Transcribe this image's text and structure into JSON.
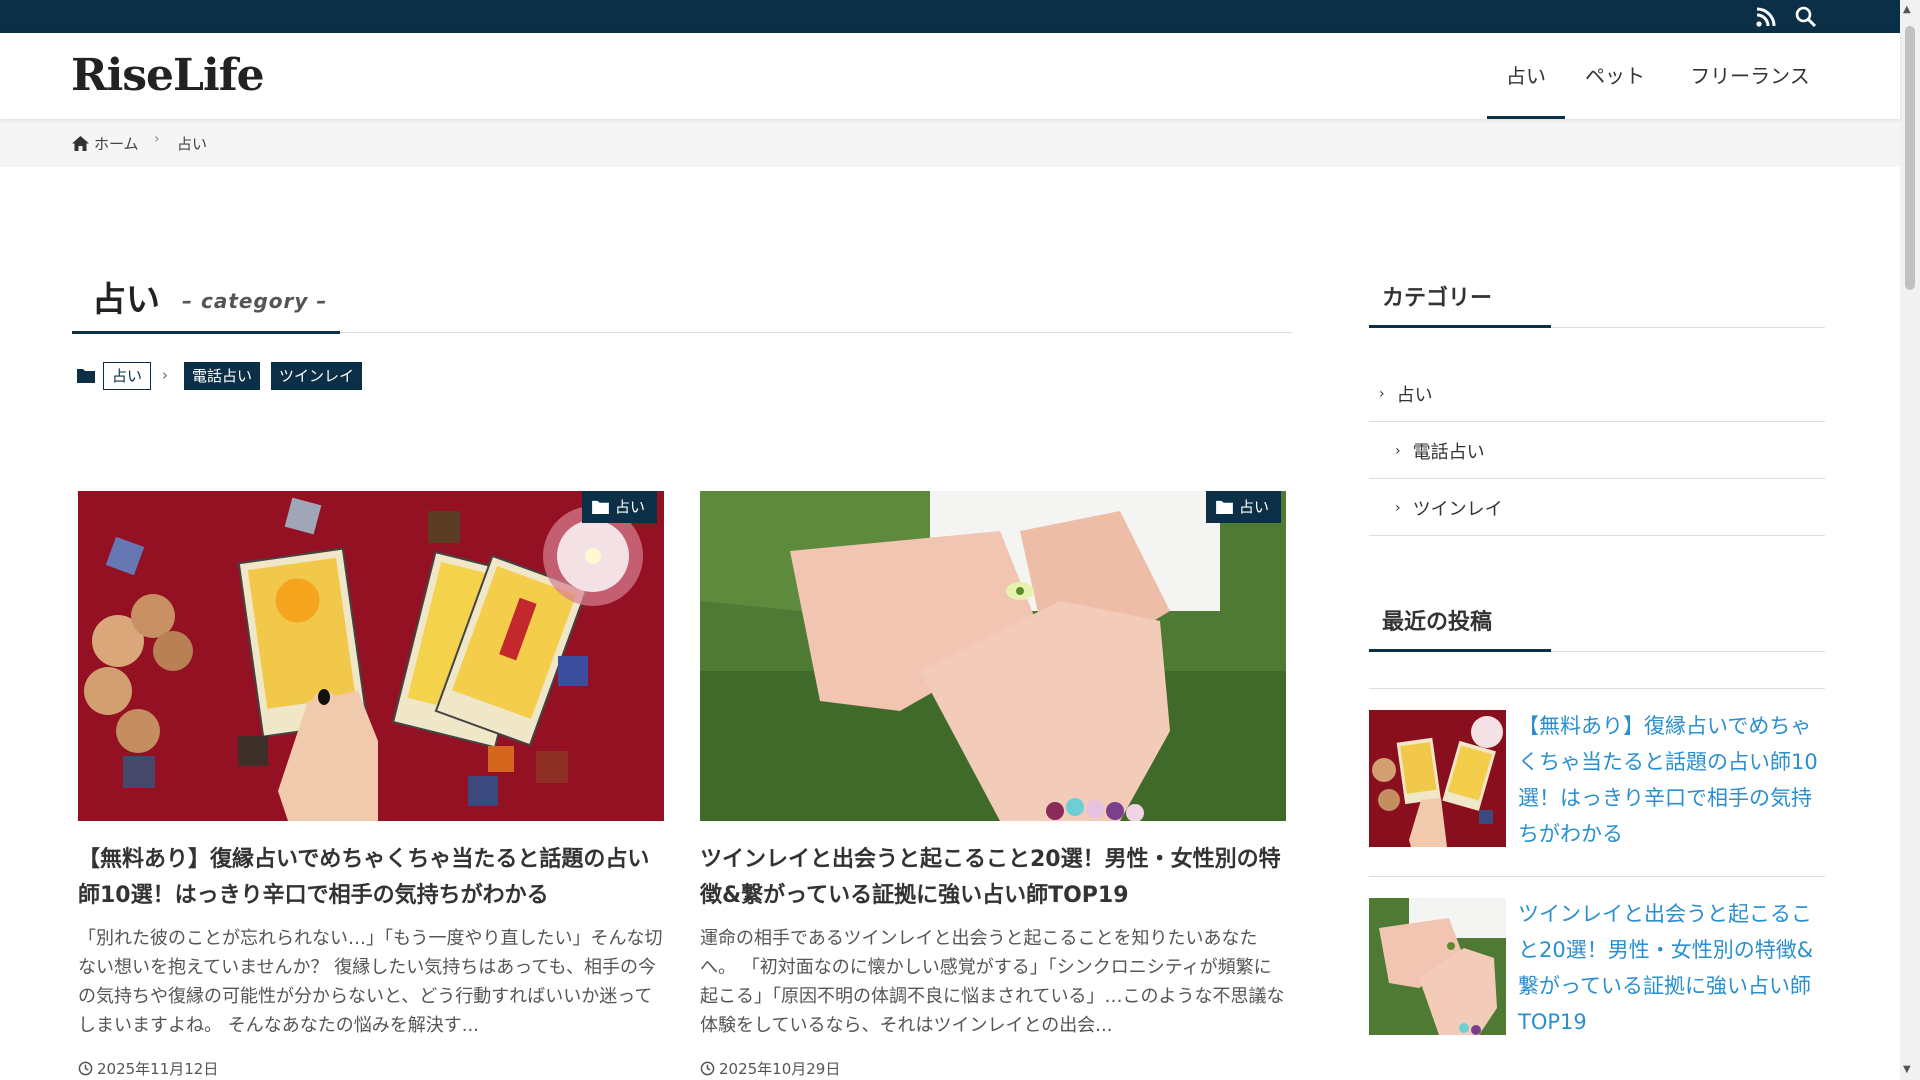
{
  "header": {
    "logo": "RiseLife",
    "nav": [
      {
        "label": "占い",
        "active": true
      },
      {
        "label": "ペット",
        "active": false
      },
      {
        "label": "フリーランス",
        "active": false
      }
    ],
    "top_icons": [
      "rss-icon",
      "search-icon"
    ]
  },
  "breadcrumb": {
    "home": "ホーム",
    "current": "占い"
  },
  "category": {
    "title": "占い",
    "subtitle": "– category –",
    "tags": [
      "占い",
      "電話占い",
      "ツインレイ"
    ]
  },
  "posts": [
    {
      "badge": "占い",
      "title": "【無料あり】復縁占いでめちゃくちゃ当たると話題の占い師10選！はっきり辛口で相手の気持ちがわかる",
      "excerpt": "「別れた彼のことが忘れられない…」「もう一度やり直したい」そんな切ない想いを抱えていませんか？ 復縁したい気持ちはあっても、相手の今の気持ちや復縁の可能性が分からないと、どう行動すればいいか迷ってしまいますよね。 そんなあなたの悩みを解決す...",
      "date": "2025年11月12日"
    },
    {
      "badge": "占い",
      "title": "ツインレイと出会うと起こること20選！男性・女性別の特徴&繋がっている証拠に強い占い師TOP19",
      "excerpt": "運命の相手であるツインレイと出会うと起こることを知りたいあなたへ。 「初対面なのに懐かしい感覚がする」「シンクロニシティが頻繁に起こる」「原因不明の体調不良に悩まされている」…このような不思議な体験をしているなら、それはツインレイとの出会...",
      "date": "2025年10月29日"
    }
  ],
  "sidebar": {
    "categories_heading": "カテゴリー",
    "categories": [
      "占い",
      "電話占い",
      "ツインレイ"
    ],
    "recent_heading": "最近の投稿",
    "recent": [
      "【無料あり】復縁占いでめちゃくちゃ当たると話題の占い師10選！はっきり辛口で相手の気持ちがわかる",
      "ツインレイと出会うと起こること20選！男性・女性別の特徴&繋がっている証拠に強い占い師TOP19"
    ]
  },
  "colors": {
    "brand": "#0a2f46",
    "link": "#2a8fd0"
  }
}
